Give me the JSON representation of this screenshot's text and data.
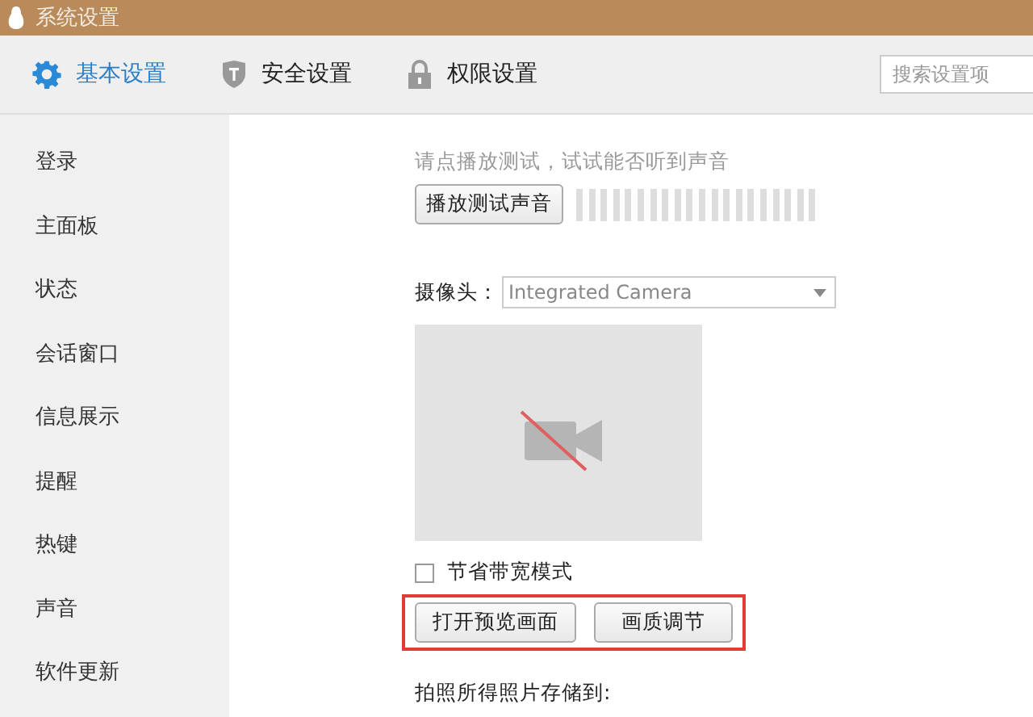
{
  "window": {
    "title": "系统设置"
  },
  "tabs": [
    {
      "label": "基本设置",
      "kind": "gear",
      "selected": true
    },
    {
      "label": "安全设置",
      "kind": "shield",
      "selected": false
    },
    {
      "label": "权限设置",
      "kind": "lock",
      "selected": false
    }
  ],
  "search": {
    "placeholder": "搜索设置项"
  },
  "sidebar": {
    "items": [
      {
        "label": "登录"
      },
      {
        "label": "主面板"
      },
      {
        "label": "状态"
      },
      {
        "label": "会话窗口"
      },
      {
        "label": "信息展示"
      },
      {
        "label": "提醒"
      },
      {
        "label": "热键"
      },
      {
        "label": "声音"
      },
      {
        "label": "软件更新"
      }
    ]
  },
  "sound_test": {
    "hint": "请点播放测试，试试能否听到声音",
    "button": "播放测试声音"
  },
  "camera": {
    "label": "摄像头：",
    "value": "Integrated Camera",
    "bandwidth_saving": {
      "label": "节省带宽模式",
      "checked": false
    },
    "buttons": [
      "打开预览画面",
      "画质调节"
    ]
  },
  "photo_storage": {
    "label": "拍照所得照片存储到:"
  }
}
